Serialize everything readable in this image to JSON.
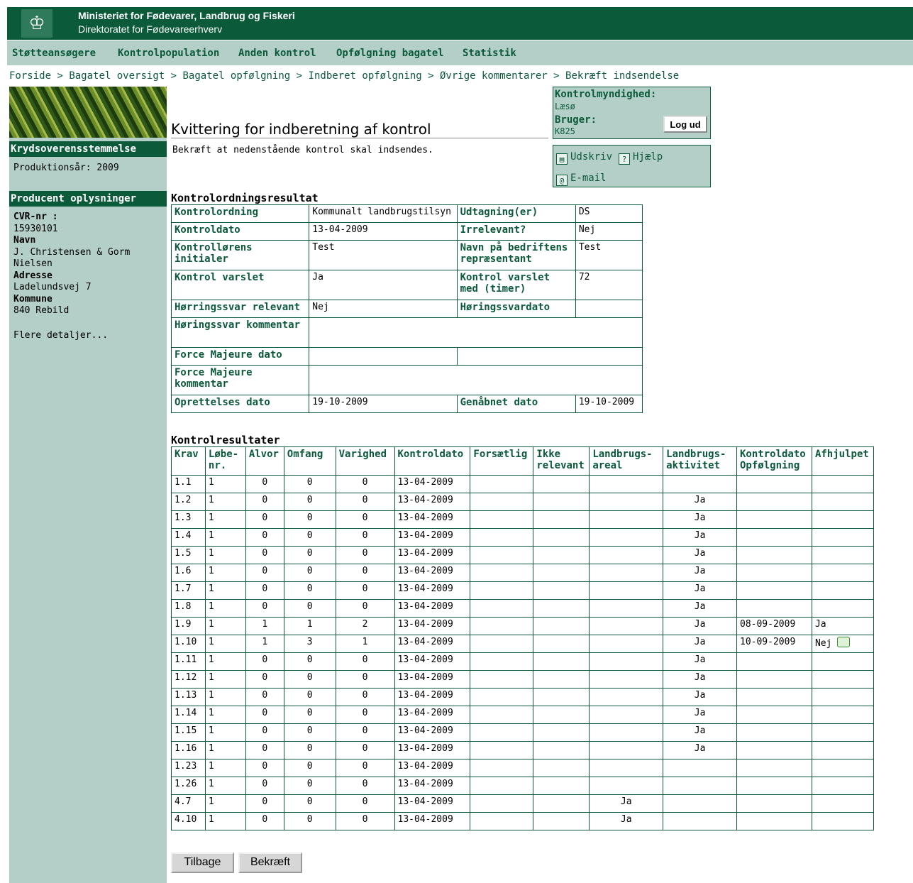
{
  "header": {
    "ministry": "Ministeriet for Fødevarer, Landbrug og Fiskeri",
    "directorate": "Direktoratet for Fødevareerhverv"
  },
  "nav": {
    "items": [
      "Støtteansøgere",
      "Kontrolpopulation",
      "Anden kontrol",
      "Opfølgning bagatel",
      "Statistik"
    ]
  },
  "breadcrumb": {
    "items": [
      "Forside",
      "Bagatel oversigt",
      "Bagatel opfølgning",
      "Indberet opfølgning",
      "Øvrige kommentarer",
      "Bekræft indsendelse"
    ],
    "separator": ">"
  },
  "sidebar": {
    "cross_title": "Krydsoverensstemmelse",
    "production_year": "Produktionsår: 2009",
    "producer_title": "Producent oplysninger",
    "cvr_label": "CVR-nr :",
    "cvr_value": "15930101",
    "name_label": "Navn",
    "name_value_1": "J. Christensen & Gorm",
    "name_value_2": "Nielsen",
    "address_label": "Adresse",
    "address_value": "Ladelundsvej 7",
    "municipality_label": "Kommune",
    "municipality_value": "840 Rebild",
    "more_details": "Flere detaljer..."
  },
  "main": {
    "title": "Kvittering for indberetning af kontrol",
    "subtitle": "Bekræft at nedenstående kontrol skal indsendes."
  },
  "info": {
    "authority_label": "Kontrolmyndighed:",
    "authority_value": "Læsø",
    "user_label": "Bruger:",
    "user_value": "K825",
    "logout": "Log ud"
  },
  "tools": {
    "print": "Udskriv",
    "help": "Hjælp",
    "email": "E-mail"
  },
  "ordning": {
    "title": "Kontrolordningsresultat",
    "kontrolordning_label": "Kontrolordning",
    "kontrolordning_value": "Kommunalt landbrugstilsyn",
    "udtagning_label": "Udtagning(er)",
    "udtagning_value": "DS",
    "kontroldato_label": "Kontroldato",
    "kontroldato_value": "13-04-2009",
    "irrelevant_label": "Irrelevant?",
    "irrelevant_value": "Nej",
    "initialer_label": "Kontrollørens initialer",
    "initialer_value": "Test",
    "repraesentant_label": "Navn på bedriftens repræsentant",
    "repraesentant_value": "Test",
    "varslet_label": "Kontrol varslet",
    "varslet_value": "Ja",
    "varslet_timer_label": "Kontrol varslet med (timer)",
    "varslet_timer_value": "72",
    "horringssvar_relevant_label": "Hørringssvar relevant",
    "horringssvar_relevant_value": "Nej",
    "horingssvardato_label": "Høringssvardato",
    "horingssvardato_value": "",
    "horingssvar_kommentar_label": "Høringssvar kommentar",
    "force_dato_label": "Force Majeure dato",
    "force_kommentar_label": "Force Majeure kommentar",
    "oprettelse_label": "Oprettelses dato",
    "oprettelse_value": "19-10-2009",
    "genabnet_label": "Genåbnet dato",
    "genabnet_value": "19-10-2009"
  },
  "results": {
    "title": "Kontrolresultater",
    "headers": [
      "Krav",
      "Løbe-nr.",
      "Alvor",
      "Omfang",
      "Varighed",
      "Kontroldato",
      "Forsætlig",
      "Ikke relevant",
      "Landbrugs-areal",
      "Landbrugs-aktivitet",
      "Kontroldato Opfølgning",
      "Afhjulpet"
    ],
    "rows": [
      [
        "1.1",
        "1",
        "0",
        "0",
        "0",
        "13-04-2009",
        "",
        "",
        "",
        "",
        "",
        ""
      ],
      [
        "1.2",
        "1",
        "0",
        "0",
        "0",
        "13-04-2009",
        "",
        "",
        "",
        "Ja",
        "",
        ""
      ],
      [
        "1.3",
        "1",
        "0",
        "0",
        "0",
        "13-04-2009",
        "",
        "",
        "",
        "Ja",
        "",
        ""
      ],
      [
        "1.4",
        "1",
        "0",
        "0",
        "0",
        "13-04-2009",
        "",
        "",
        "",
        "Ja",
        "",
        ""
      ],
      [
        "1.5",
        "1",
        "0",
        "0",
        "0",
        "13-04-2009",
        "",
        "",
        "",
        "Ja",
        "",
        ""
      ],
      [
        "1.6",
        "1",
        "0",
        "0",
        "0",
        "13-04-2009",
        "",
        "",
        "",
        "Ja",
        "",
        ""
      ],
      [
        "1.7",
        "1",
        "0",
        "0",
        "0",
        "13-04-2009",
        "",
        "",
        "",
        "Ja",
        "",
        ""
      ],
      [
        "1.8",
        "1",
        "0",
        "0",
        "0",
        "13-04-2009",
        "",
        "",
        "",
        "Ja",
        "",
        ""
      ],
      [
        "1.9",
        "1",
        "1",
        "1",
        "2",
        "13-04-2009",
        "",
        "",
        "",
        "Ja",
        "08-09-2009",
        "Ja"
      ],
      [
        "1.10",
        "1",
        "1",
        "3",
        "1",
        "13-04-2009",
        "",
        "",
        "",
        "Ja",
        "10-09-2009",
        "Nej"
      ],
      [
        "1.11",
        "1",
        "0",
        "0",
        "0",
        "13-04-2009",
        "",
        "",
        "",
        "Ja",
        "",
        ""
      ],
      [
        "1.12",
        "1",
        "0",
        "0",
        "0",
        "13-04-2009",
        "",
        "",
        "",
        "Ja",
        "",
        ""
      ],
      [
        "1.13",
        "1",
        "0",
        "0",
        "0",
        "13-04-2009",
        "",
        "",
        "",
        "Ja",
        "",
        ""
      ],
      [
        "1.14",
        "1",
        "0",
        "0",
        "0",
        "13-04-2009",
        "",
        "",
        "",
        "Ja",
        "",
        ""
      ],
      [
        "1.15",
        "1",
        "0",
        "0",
        "0",
        "13-04-2009",
        "",
        "",
        "",
        "Ja",
        "",
        ""
      ],
      [
        "1.16",
        "1",
        "0",
        "0",
        "0",
        "13-04-2009",
        "",
        "",
        "",
        "Ja",
        "",
        ""
      ],
      [
        "1.23",
        "1",
        "0",
        "0",
        "0",
        "13-04-2009",
        "",
        "",
        "",
        "",
        "",
        ""
      ],
      [
        "1.26",
        "1",
        "0",
        "0",
        "0",
        "13-04-2009",
        "",
        "",
        "",
        "",
        "",
        ""
      ],
      [
        "4.7",
        "1",
        "0",
        "0",
        "0",
        "13-04-2009",
        "",
        "",
        "Ja",
        "",
        "",
        ""
      ],
      [
        "4.10",
        "1",
        "0",
        "0",
        "0",
        "13-04-2009",
        "",
        "",
        "Ja",
        "",
        "",
        ""
      ]
    ]
  },
  "buttons": {
    "back": "Tilbage",
    "confirm": "Bekræft"
  }
}
